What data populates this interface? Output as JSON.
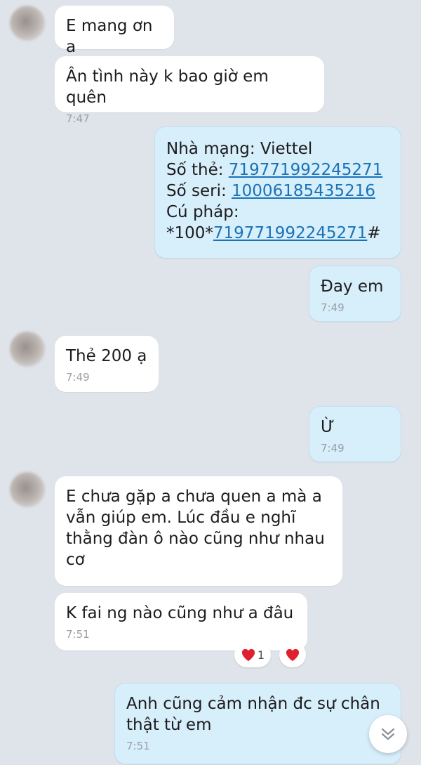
{
  "messages": [
    {
      "text": "E mang ơn a"
    },
    {
      "text": "Ân tình này k bao giờ em quên",
      "time": "7:47"
    },
    {
      "lines": {
        "carrier": "Nhà mạng: Viettel",
        "card_label": "Số thẻ: ",
        "card_number": "719771992245271",
        "serial_label": "Số seri: ",
        "serial_number": "10006185435216",
        "syntax_label": "Cú pháp:",
        "syntax_prefix": "*100*",
        "syntax_code": "719771992245271",
        "syntax_suffix": "#"
      }
    },
    {
      "text": "Đay em",
      "time": "7:49"
    },
    {
      "text": "Thẻ 200 ạ",
      "time": "7:49"
    },
    {
      "text": "Ừ",
      "time": "7:49"
    },
    {
      "text": "E chưa gặp a chưa quen a mà a vẫn giúp em. Lúc đầu e nghĩ thằng đàn ô nào cũng như nhau cơ"
    },
    {
      "text": "K fai ng nào cũng như a đâu",
      "time": "7:51",
      "reaction_count": "1"
    },
    {
      "text": "Anh cũng cảm nhận đc sự chân thật từ em",
      "time": "7:51"
    }
  ],
  "icons": {
    "reaction": "heart-icon",
    "scroll": "chevron-double-down-icon"
  },
  "colors": {
    "incoming": "#ffffff",
    "outgoing": "#d7eefb",
    "link": "#1a73b8",
    "heart": "#e0202e"
  }
}
